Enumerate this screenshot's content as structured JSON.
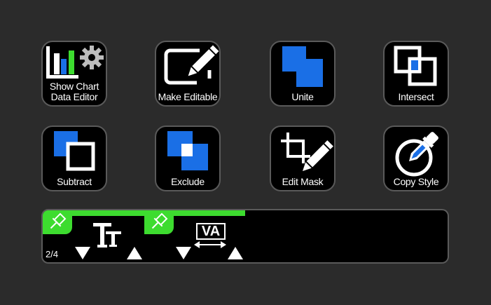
{
  "keys": [
    {
      "id": "show-chart-data-editor",
      "label": "Show Chart\nData Editor",
      "icon": "chart-gear-icon"
    },
    {
      "id": "make-editable",
      "label": "Make Editable",
      "icon": "edit-pencil-icon"
    },
    {
      "id": "unite",
      "label": "Unite",
      "icon": "unite-icon"
    },
    {
      "id": "intersect",
      "label": "Intersect",
      "icon": "intersect-icon"
    },
    {
      "id": "subtract",
      "label": "Subtract",
      "icon": "subtract-icon"
    },
    {
      "id": "exclude",
      "label": "Exclude",
      "icon": "exclude-icon"
    },
    {
      "id": "edit-mask",
      "label": "Edit Mask",
      "icon": "crop-pencil-icon"
    },
    {
      "id": "copy-style",
      "label": "Copy Style",
      "icon": "eyedropper-icon"
    }
  ],
  "strip": {
    "page_indicator": "2/4",
    "progress_fraction": 0.5,
    "dials": [
      {
        "id": "font-size",
        "icon": "text-size-icon",
        "pinned": true
      },
      {
        "id": "character-spacing",
        "icon": "tracking-icon",
        "text": "VA",
        "pinned": true
      }
    ]
  },
  "colors": {
    "background": "#2b2b2b",
    "key": "#000000",
    "border": "#5a5a5a",
    "accent_blue": "#1a6fe6",
    "accent_green": "#3ddc2f",
    "chart_green": "#3ddc2f"
  }
}
